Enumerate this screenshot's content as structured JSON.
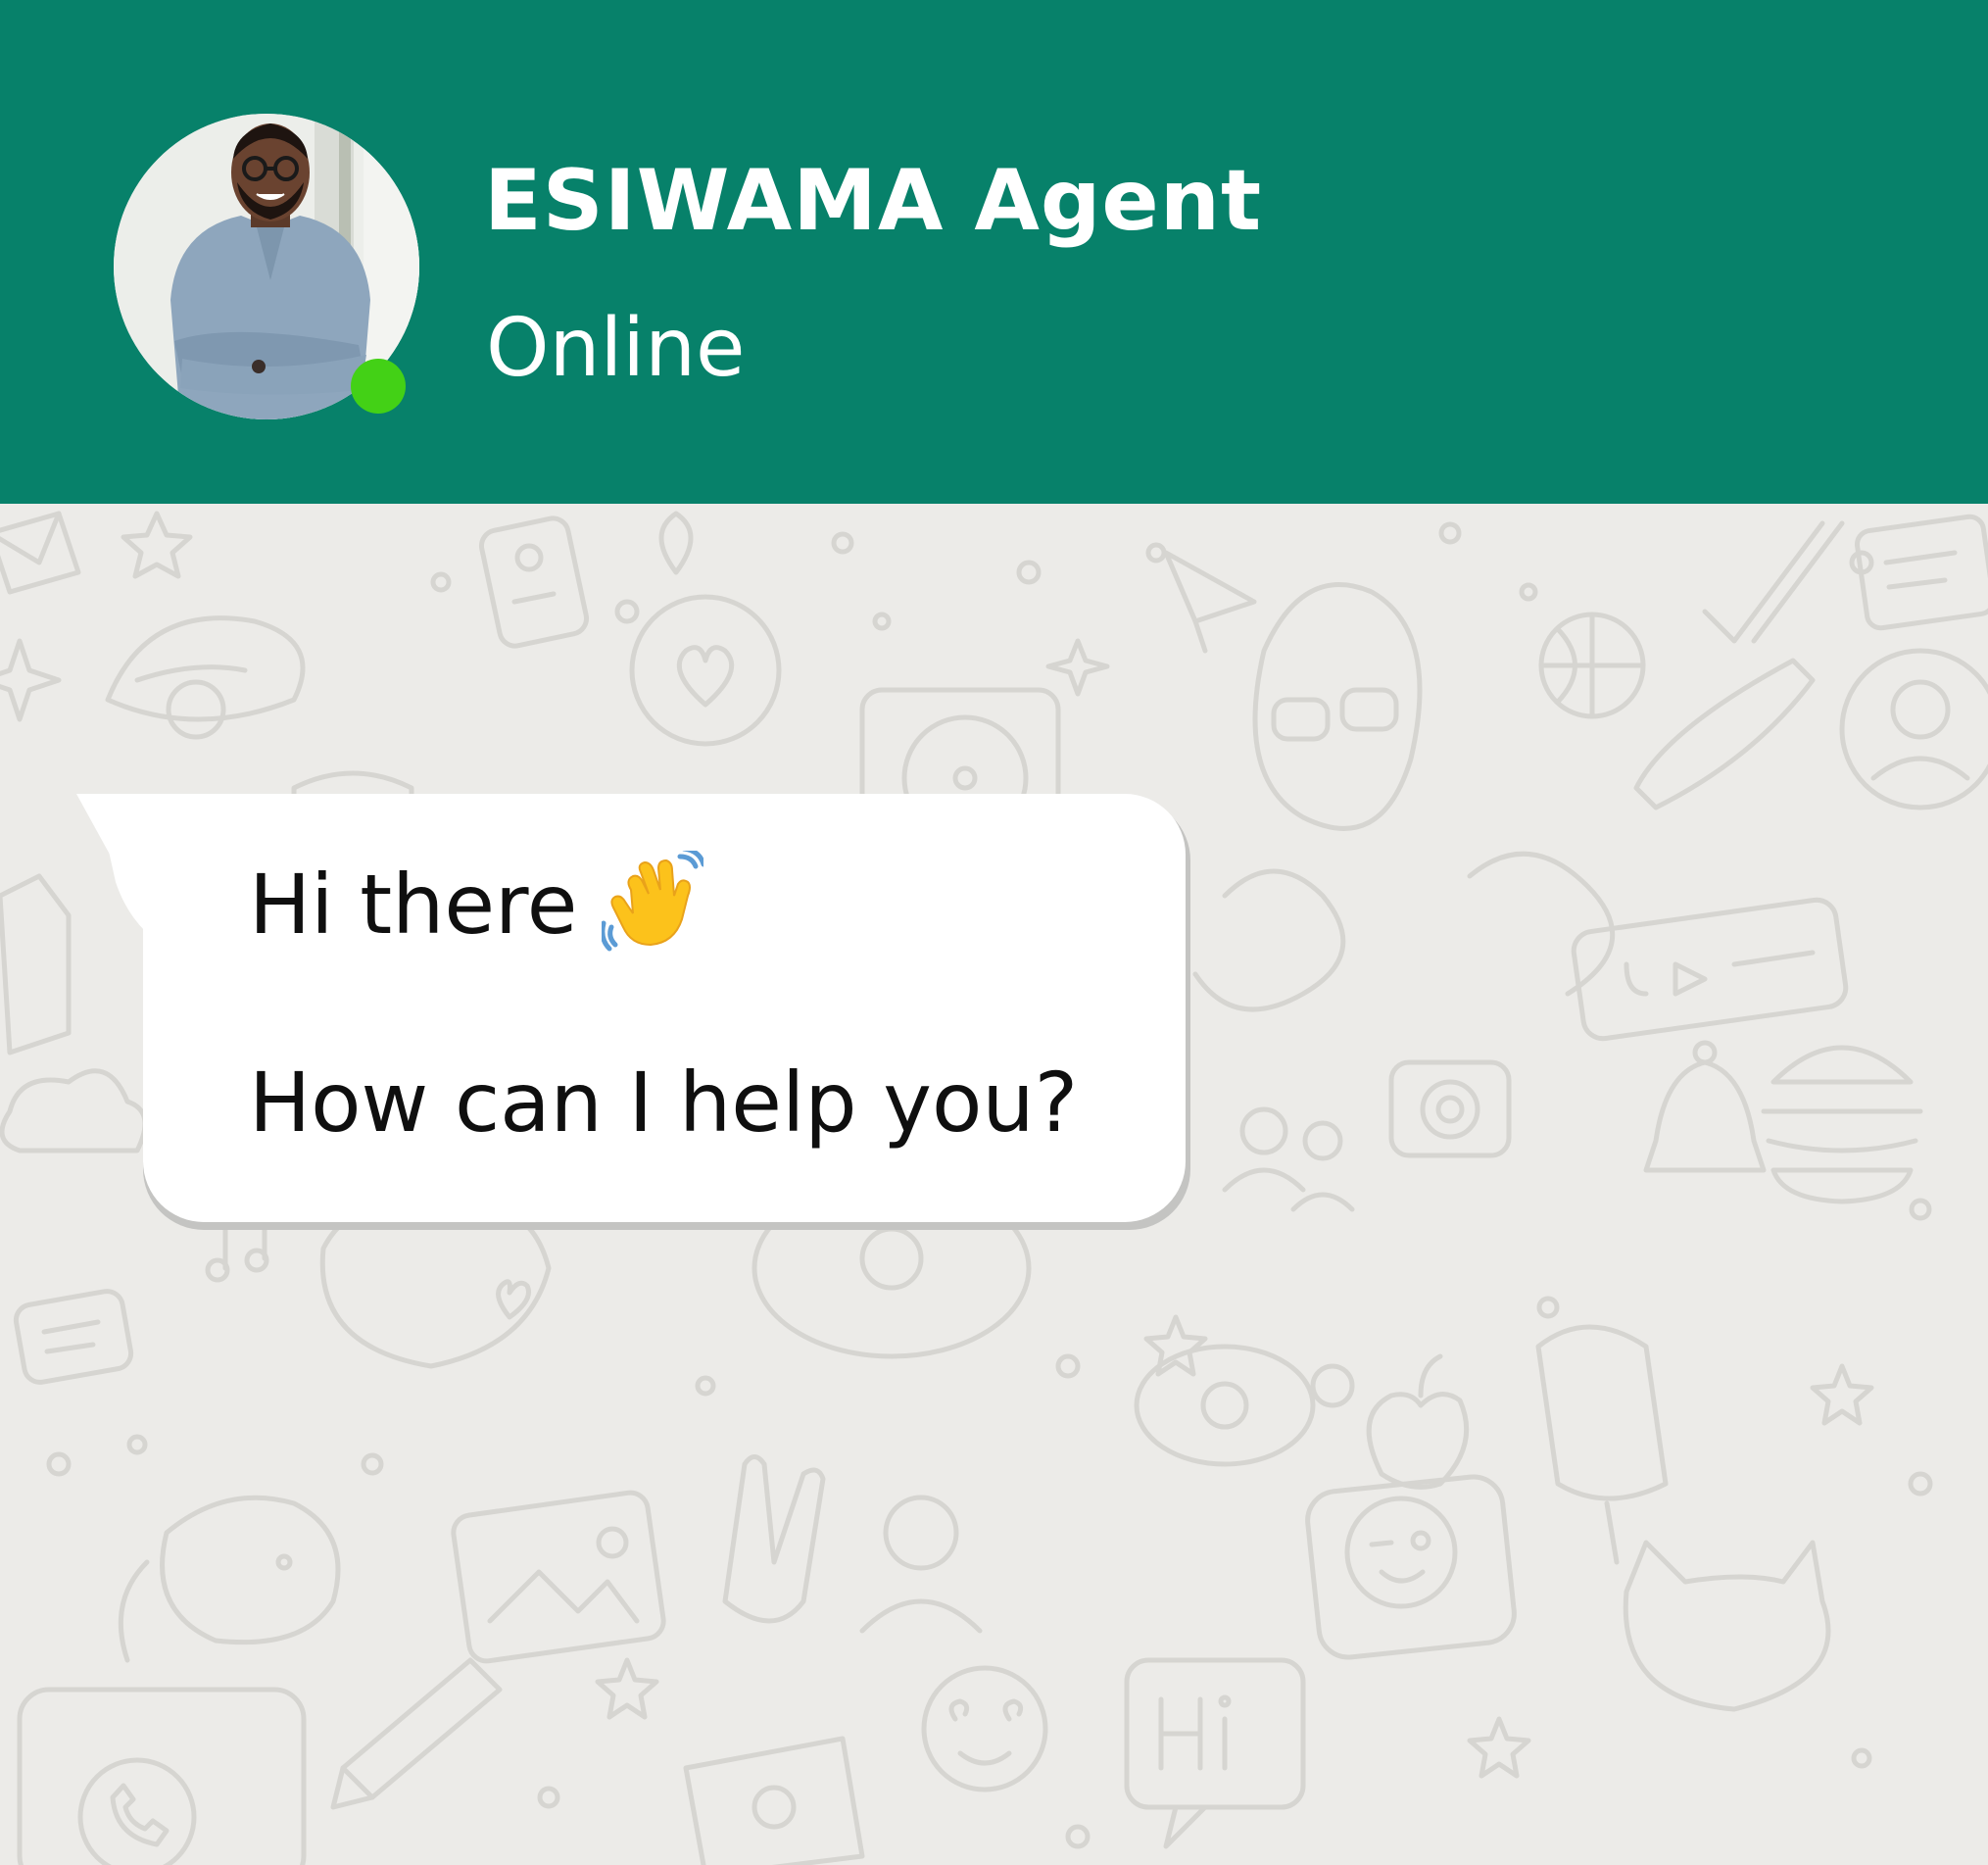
{
  "contact": {
    "name": "ESIWAMA Agent",
    "status": "Online",
    "avatar_icon": "agent-avatar-photo",
    "presence_color": "#43d116"
  },
  "theme": {
    "header_color": "#07816a",
    "chat_background": "#ecebe8",
    "bubble_color": "#ffffff"
  },
  "message": {
    "line1": "Hi there",
    "line1_icon": "waving-hand-emoji",
    "line2": "How can I help you?"
  },
  "background_icons": [
    "envelope-icon",
    "star-icon",
    "cap-icon",
    "clipboard-icon",
    "location-pin-icon",
    "paper-plane-icon",
    "double-check-icon",
    "card-icon",
    "heart-icon",
    "vinyl-record-icon",
    "sunglasses-icon",
    "basketball-icon",
    "shoe-icon",
    "profile-icon",
    "play-bar-icon",
    "camera-icon",
    "burger-icon",
    "bell-icon",
    "people-icon",
    "message-card-icon",
    "cloud-icon",
    "donut-icon",
    "popsicle-icon",
    "turtle-icon",
    "cat-icon",
    "dog-icon",
    "picture-frame-icon",
    "peace-hand-icon",
    "person-icon",
    "wink-face-icon",
    "heart-eyes-face-icon",
    "hi-speech-bubble-icon",
    "phone-icon",
    "pencil-icon",
    "apple-icon"
  ]
}
